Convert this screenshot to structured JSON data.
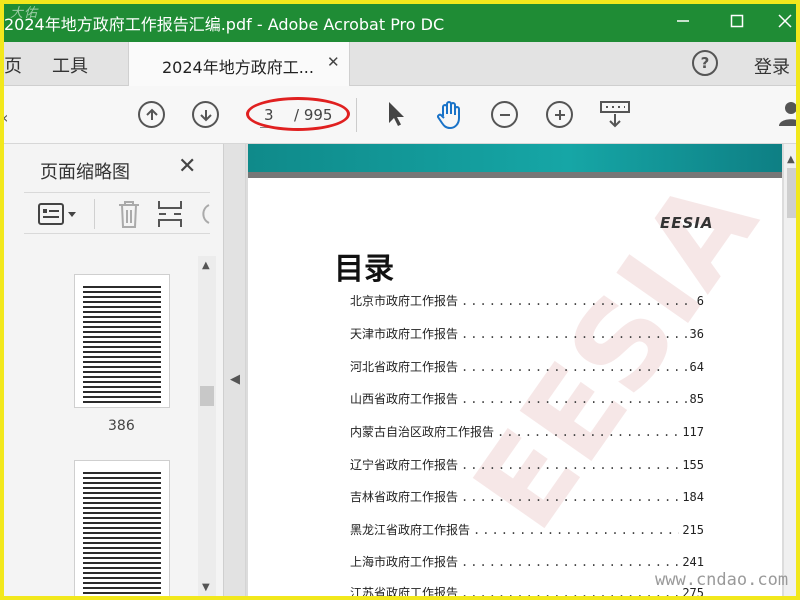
{
  "window": {
    "title": "2024年地方政府工作报告汇编.pdf - Adobe Acrobat Pro DC",
    "overlay_mark": "大佑"
  },
  "tabbar": {
    "menu_home": "页",
    "menu_tools": "工具",
    "doc_tab_label": "2024年地方政府工...",
    "login": "登录"
  },
  "toolbar": {
    "current_page": "3",
    "total_pages": "/ 995"
  },
  "left_panel": {
    "title": "页面缩略图",
    "thumb_page_label": "386"
  },
  "document": {
    "brand": "EESIA",
    "toc_title": "目录",
    "watermark": "EESIA",
    "toc": [
      {
        "name": "北京市政府工作报告",
        "page": "6"
      },
      {
        "name": "天津市政府工作报告",
        "page": "36"
      },
      {
        "name": "河北省政府工作报告",
        "page": "64"
      },
      {
        "name": "山西省政府工作报告",
        "page": "85"
      },
      {
        "name": "内蒙古自治区政府工作报告",
        "page": "117"
      },
      {
        "name": "辽宁省政府工作报告",
        "page": "155"
      },
      {
        "name": "吉林省政府工作报告",
        "page": "184"
      },
      {
        "name": "黑龙江省政府工作报告",
        "page": "215"
      },
      {
        "name": "上海市政府工作报告",
        "page": "241"
      },
      {
        "name": "江苏省政府工作报告",
        "page": "275"
      }
    ]
  },
  "site_watermark": "www.cndao.com",
  "colors": {
    "titlebar": "#1f8c35",
    "frame": "#f2e81c",
    "highlight": "#e02020",
    "hand_tool": "#1a73c8"
  }
}
